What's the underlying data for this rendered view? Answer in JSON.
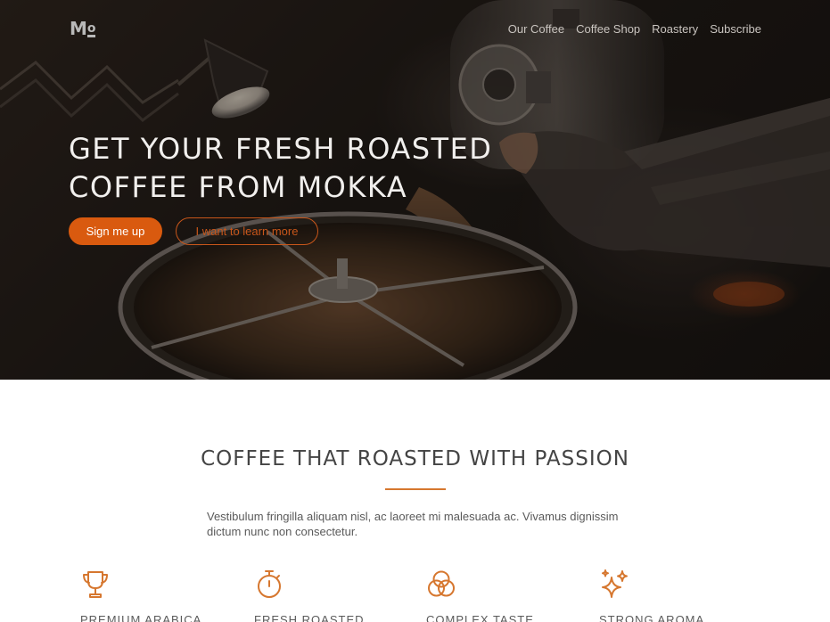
{
  "brand": {
    "logo_text": "M",
    "logo_mark": "o"
  },
  "nav": {
    "items": [
      {
        "label": "Our Coffee"
      },
      {
        "label": "Coffee Shop"
      },
      {
        "label": "Roastery"
      },
      {
        "label": "Subscribe"
      }
    ]
  },
  "hero": {
    "title_line1": "GET YOUR FRESH ROASTED",
    "title_line2": "COFFEE FROM MOKKA",
    "primary_button": "Sign me up",
    "secondary_button": "I want to learn more",
    "image_icon": "coffee-roaster-photo"
  },
  "intro": {
    "title": "COFFEE THAT ROASTED WITH PASSION",
    "description": "Vestibulum fringilla aliquam nisl, ac laoreet mi malesuada ac. Vivamus dignissim dictum nunc non consectetur."
  },
  "features": [
    {
      "icon": "trophy-icon",
      "label": "PREMIUM ARABICA"
    },
    {
      "icon": "stopwatch-icon",
      "label": "FRESH ROASTED"
    },
    {
      "icon": "circles-icon",
      "label": "COMPLEX TASTE"
    },
    {
      "icon": "sparkles-icon",
      "label": "STRONG AROMA"
    }
  ],
  "colors": {
    "accent": "#d95a0f",
    "hero_bg": "#1a1512",
    "text": "#444444"
  }
}
